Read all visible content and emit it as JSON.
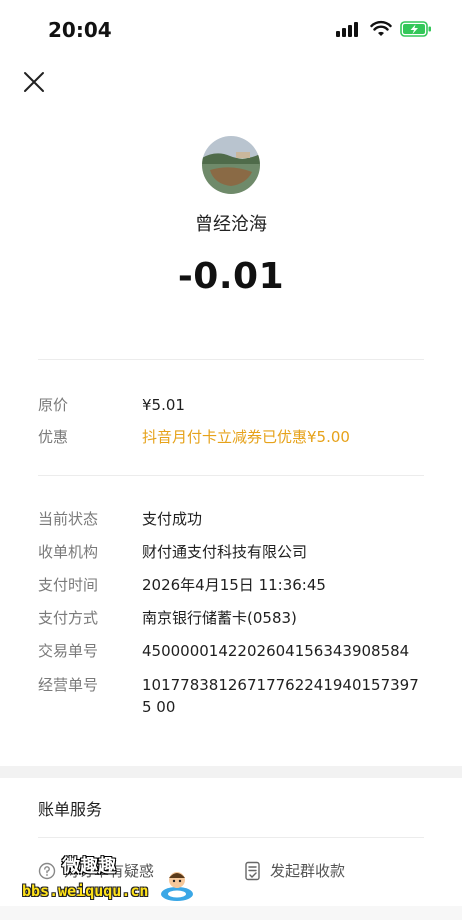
{
  "status_bar": {
    "time": "20:04"
  },
  "header": {
    "close_icon": "close-icon"
  },
  "merchant": {
    "name": "曾经沧海",
    "amount": "-0.01"
  },
  "price_section": [
    {
      "label": "原价",
      "value": "¥5.01",
      "accent": false
    },
    {
      "label": "优惠",
      "value": "抖音月付卡立减券已优惠¥5.00",
      "accent": true
    }
  ],
  "details": [
    {
      "label": "当前状态",
      "value": "支付成功"
    },
    {
      "label": "收单机构",
      "value": "财付通支付科技有限公司"
    },
    {
      "label": "支付时间",
      "value": "2026年4月15日 11:36:45"
    },
    {
      "label": "支付方式",
      "value": "南京银行储蓄卡(0583)"
    },
    {
      "label": "交易单号",
      "value": "4500000142202604156343908584"
    },
    {
      "label": "经营单号",
      "value": "101778381267177622419401573975 00"
    }
  ],
  "bill_services": {
    "title": "账单服务",
    "items": [
      {
        "label": "对订单有疑惑",
        "icon": "question-circle-icon"
      },
      {
        "label": "发起群收款",
        "icon": "group-collect-icon"
      }
    ]
  },
  "watermark": {
    "brand": "微趣趣",
    "url": "bbs.weiququ.cn"
  },
  "colors": {
    "accent": "#e6a21a",
    "label_gray": "#7a7a7a",
    "battery_green": "#34c759"
  }
}
